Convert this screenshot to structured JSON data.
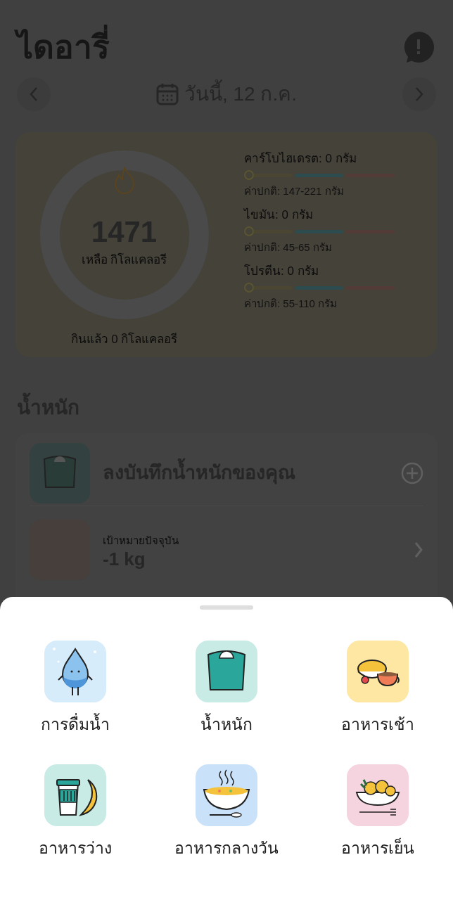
{
  "header": {
    "title": "ไดอารี่"
  },
  "date_nav": {
    "label": "วันนี้, 12 ก.ค."
  },
  "calorie_card": {
    "remaining": "1471",
    "remaining_label": "เหลือ กิโลแคลอรี",
    "eaten": "กินแล้ว 0 กิโลแคลอรี",
    "macros": [
      {
        "label": "คาร์โบไฮเดรต: 0 กรัม",
        "level": 0,
        "normal": "ค่าปกติ: 147-221 กรัม"
      },
      {
        "label": "ไขมัน: 0 กรัม",
        "level": 0,
        "normal": "ค่าปกติ: 45-65 กรัม"
      },
      {
        "label": "โปรตีน: 0 กรัม",
        "level": 0,
        "normal": "ค่าปกติ: 55-110 กรัม"
      }
    ]
  },
  "weight": {
    "heading": "น้ำหนัก",
    "log_label": "ลงบันทึกน้ำหนักของคุณ",
    "goal_caption": "เป้าหมายปัจจุบัน",
    "goal_value": "-1 kg"
  },
  "sheet": {
    "items": [
      {
        "kind": "water",
        "label": "การดื่มน้ำ"
      },
      {
        "kind": "weight",
        "label": "น้ำหนัก"
      },
      {
        "kind": "breakfast",
        "label": "อาหารเช้า"
      },
      {
        "kind": "snack",
        "label": "อาหารว่าง"
      },
      {
        "kind": "lunch",
        "label": "อาหารกลางวัน"
      },
      {
        "kind": "dinner",
        "label": "อาหารเย็น"
      }
    ]
  }
}
